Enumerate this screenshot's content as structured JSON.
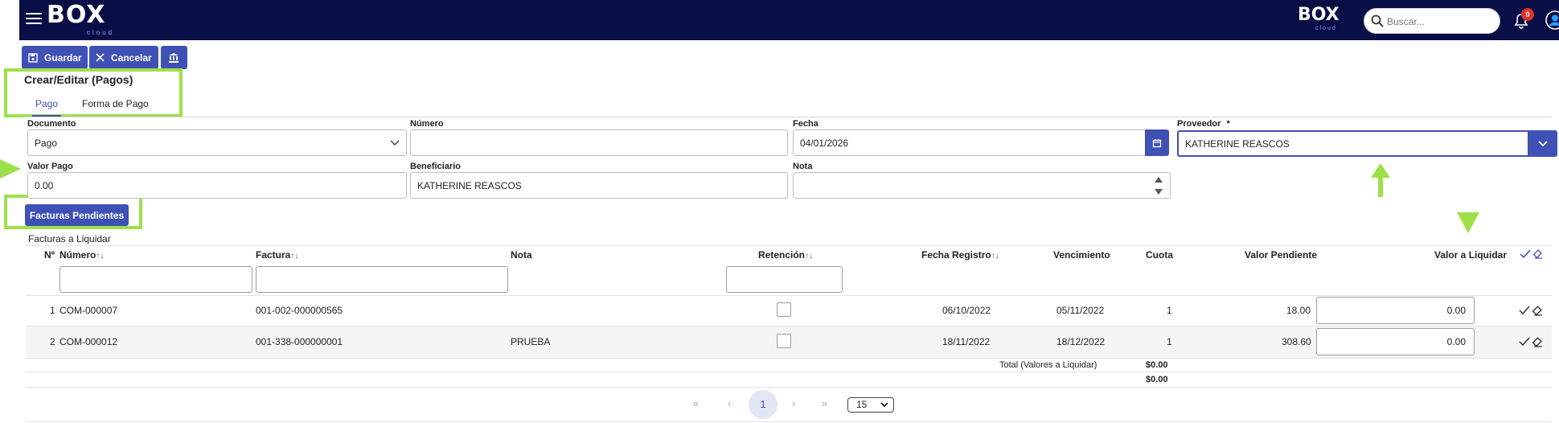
{
  "header": {
    "logo_text": "BOX",
    "logo_sub": "cloud",
    "search_placeholder": "Buscar...",
    "notification_count": "0"
  },
  "toolbar": {
    "save_label": "Guardar",
    "cancel_label": "Cancelar"
  },
  "page": {
    "title": "Crear/Editar (Pagos)",
    "tabs": [
      {
        "label": "Pago",
        "active": true
      },
      {
        "label": "Forma de Pago",
        "active": false
      }
    ]
  },
  "form": {
    "documento": {
      "label": "Documento",
      "value": "Pago"
    },
    "numero": {
      "label": "Número",
      "value": ""
    },
    "fecha": {
      "label": "Fecha",
      "value": "04/01/2026"
    },
    "proveedor": {
      "label": "Proveedor",
      "required_mark": "*",
      "value": "KATHERINE REASCOS"
    },
    "valor_pago": {
      "label": "Valor Pago",
      "value": "0.00"
    },
    "beneficiario": {
      "label": "Beneficiario",
      "value": "KATHERINE REASCOS"
    },
    "nota": {
      "label": "Nota",
      "value": ""
    }
  },
  "pending_button_label": "Facturas Pendientes",
  "table": {
    "caption": "Facturas a Liquidar",
    "columns": {
      "no": "Nº",
      "numero": "Número",
      "factura": "Factura",
      "nota": "Nota",
      "retencion": "Retención",
      "fecha_registro": "Fecha Registro",
      "vencimiento": "Vencimiento",
      "cuota": "Cuota",
      "valor_pendiente": "Valor Pendiente",
      "valor_liquidar": "Valor a Liquidar"
    },
    "sort_glyph": "↑↓",
    "rows": [
      {
        "no": "1",
        "numero": "COM-000007",
        "factura": "001-002-000000565",
        "nota": "",
        "retencion": false,
        "fecha_registro": "06/10/2022",
        "vencimiento": "05/11/2022",
        "cuota": "1",
        "valor_pendiente": "18.00",
        "valor_liquidar": "0.00"
      },
      {
        "no": "2",
        "numero": "COM-000012",
        "factura": "001-338-000000001",
        "nota": "PRUEBA",
        "retencion": false,
        "fecha_registro": "18/11/2022",
        "vencimiento": "18/12/2022",
        "cuota": "1",
        "valor_pendiente": "308.60",
        "valor_liquidar": "0.00"
      }
    ],
    "total_label": "Total (Valores a Liquidar)",
    "total_value": "$0.00",
    "total_value_2": "$0.00"
  },
  "pagination": {
    "first": "«",
    "prev": "‹",
    "current": "1",
    "next": "›",
    "last": "»",
    "page_size": "15"
  },
  "colors": {
    "header_bg": "#0a0e46",
    "primary": "#3f51b5",
    "highlight": "#9ee04a"
  }
}
